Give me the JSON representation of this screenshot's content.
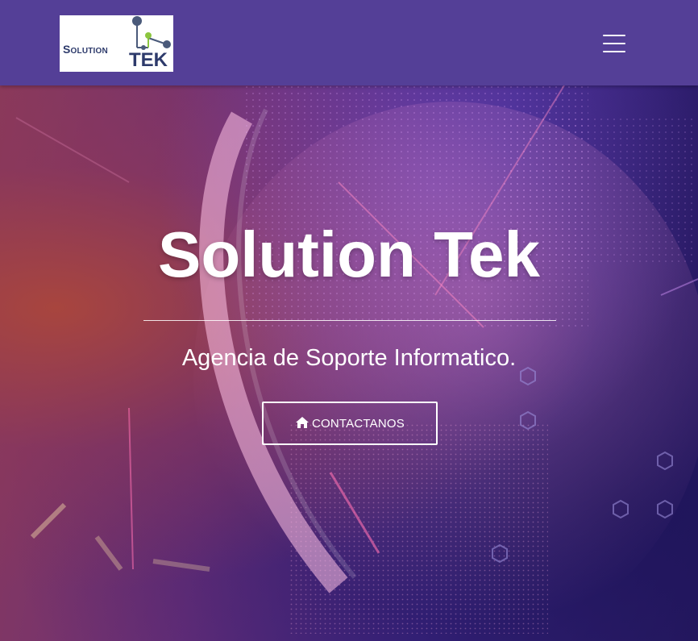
{
  "navbar": {
    "logo": {
      "word_1": "Solution",
      "word_2": "TEK"
    },
    "menu_icon": "hamburger-menu-icon"
  },
  "hero": {
    "title": "Solution Tek",
    "subtitle": "Agencia de Soporte Informatico.",
    "cta": {
      "icon": "home-icon",
      "label": "CONTACTANOS"
    }
  },
  "colors": {
    "navbar_bg": "#543f97",
    "logo_text": "#2d3a6b",
    "logo_accent_green": "#8cc63f",
    "logo_node": "#4a5a7a",
    "text_on_hero": "#ffffff"
  }
}
